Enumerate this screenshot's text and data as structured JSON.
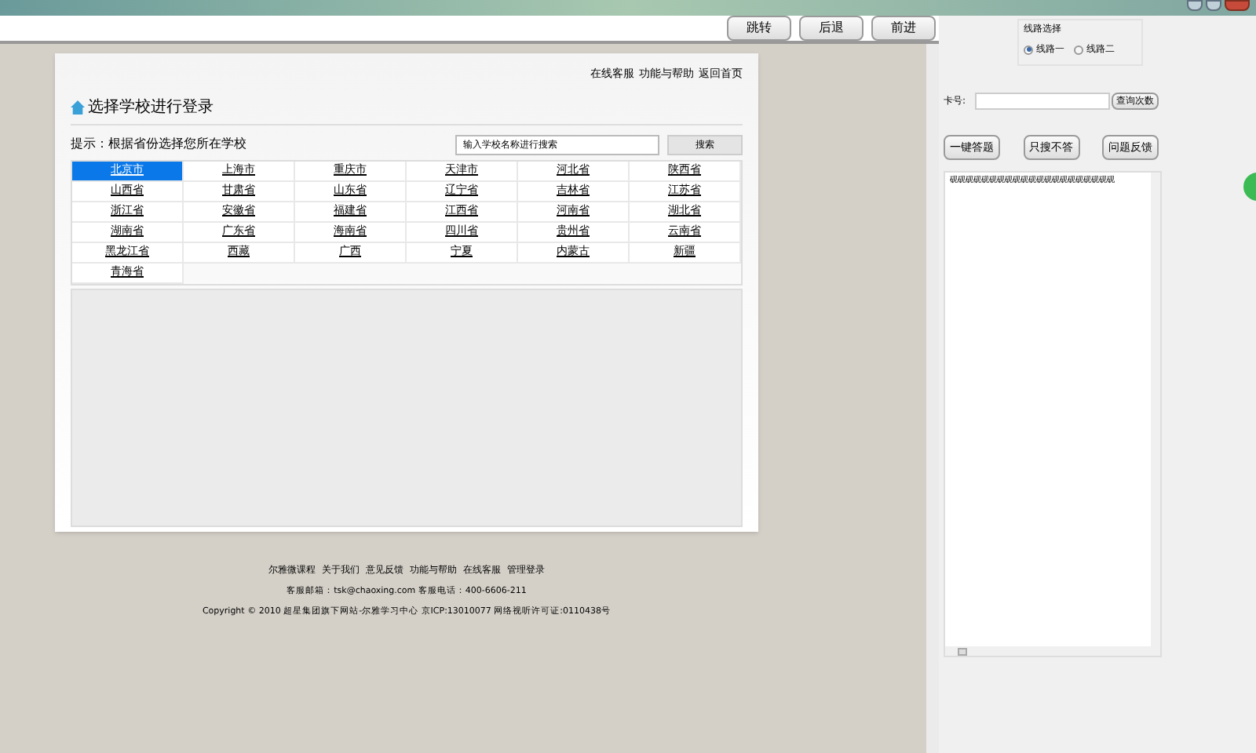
{
  "toolbar": {
    "buttons": [
      "跳转",
      "后退",
      "前进"
    ]
  },
  "page": {
    "top_links": [
      "在线客服",
      "功能与帮助",
      "返回首页"
    ],
    "heading": "选择学校进行登录",
    "hint": "提示：根据省份选择您所在学校",
    "search": {
      "value": "输入学校名称进行搜索",
      "button": "搜索"
    },
    "provinces": [
      {
        "label": "北京市",
        "selected": true
      },
      {
        "label": "上海市",
        "selected": false
      },
      {
        "label": "重庆市",
        "selected": false
      },
      {
        "label": "天津市",
        "selected": false
      },
      {
        "label": "河北省",
        "selected": false
      },
      {
        "label": "陕西省",
        "selected": false
      },
      {
        "label": "山西省",
        "selected": false
      },
      {
        "label": "甘肃省",
        "selected": false
      },
      {
        "label": "山东省",
        "selected": false
      },
      {
        "label": "辽宁省",
        "selected": false
      },
      {
        "label": "吉林省",
        "selected": false
      },
      {
        "label": "江苏省",
        "selected": false
      },
      {
        "label": "浙江省",
        "selected": false
      },
      {
        "label": "安徽省",
        "selected": false
      },
      {
        "label": "福建省",
        "selected": false
      },
      {
        "label": "江西省",
        "selected": false
      },
      {
        "label": "河南省",
        "selected": false
      },
      {
        "label": "湖北省",
        "selected": false
      },
      {
        "label": "湖南省",
        "selected": false
      },
      {
        "label": "广东省",
        "selected": false
      },
      {
        "label": "海南省",
        "selected": false
      },
      {
        "label": "四川省",
        "selected": false
      },
      {
        "label": "贵州省",
        "selected": false
      },
      {
        "label": "云南省",
        "selected": false
      },
      {
        "label": "黑龙江省",
        "selected": false
      },
      {
        "label": "西藏",
        "selected": false
      },
      {
        "label": "广西",
        "selected": false
      },
      {
        "label": "宁夏",
        "selected": false
      },
      {
        "label": "内蒙古",
        "selected": false
      },
      {
        "label": "新疆",
        "selected": false
      },
      {
        "label": "青海省",
        "selected": false
      }
    ]
  },
  "footer": {
    "links": [
      "尔雅微课程",
      "关于我们",
      "意见反馈",
      "功能与帮助",
      "在线客服",
      "管理登录"
    ],
    "contact": "客服邮箱：tsk@chaoxing.com  客服电话：400-6606-211",
    "copyright": "Copyright © 2010 超星集团旗下网站-尔雅学习中心 京ICP:13010077 网络视听许可证:0110438号"
  },
  "side": {
    "route_group": {
      "title": "线路选择",
      "options": [
        {
          "label": "线路一",
          "selected": true
        },
        {
          "label": "线路二",
          "selected": false
        }
      ]
    },
    "card": {
      "label": "卡号:",
      "button": "查询次数"
    },
    "actions": [
      "一键答题",
      "只搜不答",
      "问题反馈"
    ],
    "log": "砚砚砚砚砚砚砚砚砚砚砚砚砚砚砚砚砚砚砚砚砚"
  }
}
